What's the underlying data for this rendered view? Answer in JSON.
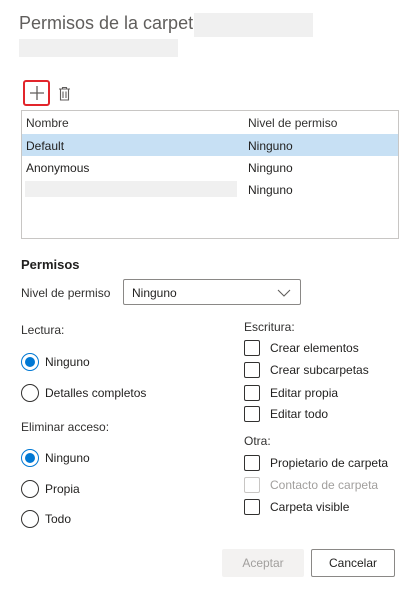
{
  "dialog": {
    "title": "Permisos de la carpeta"
  },
  "toolbar": {
    "add_icon": "plus-icon",
    "delete_icon": "trash-icon"
  },
  "list": {
    "columns": [
      "Nombre",
      "Nivel de permiso"
    ],
    "rows": [
      {
        "name": "Default",
        "level": "Ninguno",
        "selected": true
      },
      {
        "name": "Anonymous",
        "level": "Ninguno",
        "selected": false
      },
      {
        "name": "",
        "level": "Ninguno",
        "selected": false
      }
    ]
  },
  "permissions": {
    "title": "Permisos",
    "level_label": "Nivel de permiso",
    "level_value": "Ninguno",
    "read": {
      "label": "Lectura:",
      "options": [
        "Ninguno",
        "Detalles completos"
      ],
      "selected": "Ninguno"
    },
    "delete": {
      "label": "Eliminar acceso:",
      "options": [
        "Ninguno",
        "Propia",
        "Todo"
      ],
      "selected": "Ninguno"
    },
    "write": {
      "label": "Escritura:",
      "options": [
        "Crear elementos",
        "Crear subcarpetas",
        "Editar propia",
        "Editar todo"
      ]
    },
    "other": {
      "label": "Otra:",
      "options": [
        "Propietario de carpeta",
        "Contacto de carpeta",
        "Carpeta visible"
      ],
      "disabled": [
        "Contacto de carpeta"
      ]
    }
  },
  "buttons": {
    "ok": "Aceptar",
    "cancel": "Cancelar"
  },
  "colors": {
    "accent": "#0078d4",
    "selected_row": "#c7e0f4",
    "highlight": "#e2252b"
  }
}
